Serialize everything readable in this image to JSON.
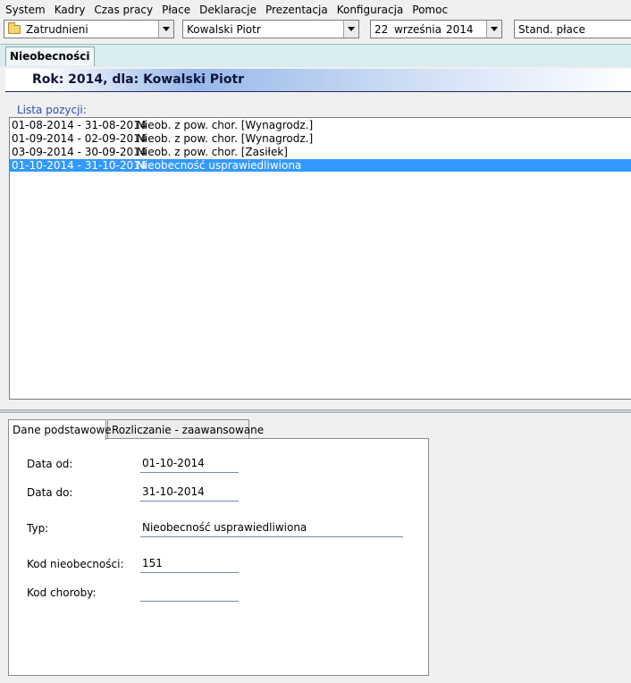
{
  "menu": [
    "System",
    "Kadry",
    "Czas pracy",
    "Płace",
    "Deklaracje",
    "Prezentacja",
    "Konfiguracja",
    "Pomoc"
  ],
  "toolbar": {
    "folder": "Zatrudnieni",
    "employee": "Kowalski Piotr",
    "date": {
      "day": "22",
      "month": "września",
      "year": "2014"
    },
    "payroll": "Stand. płace"
  },
  "main_tab": "Nieobecności",
  "header_title": "Rok: 2014, dla: Kowalski Piotr",
  "list": {
    "label": "Lista pozycji:",
    "rows": [
      {
        "dates": "01-08-2014 - 31-08-2014",
        "desc": "Nieob. z pow. chor. [Wynagrodz.]",
        "selected": false
      },
      {
        "dates": "01-09-2014 - 02-09-2014",
        "desc": "Nieob. z pow. chor. [Wynagrodz.]",
        "selected": false
      },
      {
        "dates": "03-09-2014 - 30-09-2014",
        "desc": "Nieob. z pow. chor. [Zasiłek]",
        "selected": false
      },
      {
        "dates": "01-10-2014 - 31-10-2014",
        "desc": "Nieobecność usprawiedliwiona",
        "selected": true
      }
    ]
  },
  "detail_tabs": [
    "Dane podstawowe",
    "Rozliczanie - zaawansowane"
  ],
  "fields": {
    "data_od": {
      "label": "Data od:",
      "value": "01-10-2014"
    },
    "data_do": {
      "label": "Data do:",
      "value": "31-10-2014"
    },
    "typ": {
      "label": "Typ:",
      "value": "Nieobecność usprawiedliwiona"
    },
    "kod_nieob": {
      "label": "Kod nieobecności:",
      "value": "151"
    },
    "kod_choroby": {
      "label": "Kod choroby:",
      "value": ""
    }
  },
  "colors": {
    "selection": "#3399ff",
    "label_blue": "#2a4fb0",
    "band_dark": "#1e2a6e"
  }
}
